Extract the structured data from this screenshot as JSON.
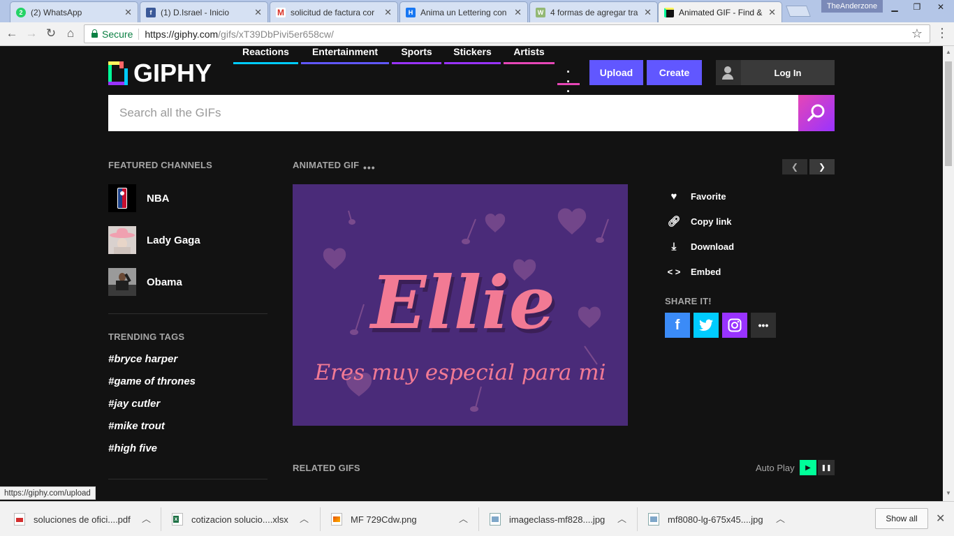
{
  "browser": {
    "tabs": [
      {
        "title": "(2) WhatsApp",
        "icon": "whatsapp-icon",
        "color": "#25d366",
        "glyph": "2"
      },
      {
        "title": "(1) D.Israel - Inicio",
        "icon": "facebook-icon",
        "color": "#3b5998",
        "glyph": "f"
      },
      {
        "title": "solicitud de factura cor",
        "icon": "gmail-icon",
        "color": "#ffffff",
        "glyph": "M"
      },
      {
        "title": "Anima un Lettering con",
        "icon": "hootsuite-icon",
        "color": "#1877f2",
        "glyph": "H"
      },
      {
        "title": "4 formas de agregar tra",
        "icon": "wikihow-icon",
        "color": "#93b874",
        "glyph": "W"
      },
      {
        "title": "Animated GIF - Find &",
        "icon": "giphy-icon",
        "color": "#121212",
        "glyph": ""
      }
    ],
    "profile_name": "TheAnderzone",
    "address": {
      "secure_label": "Secure",
      "url_host": "https://giphy.com",
      "url_path": "/gifs/xT39DbPivi5er658cw/"
    }
  },
  "header": {
    "logo_text": "GIPHY",
    "nav": [
      {
        "label": "Reactions",
        "color": "#00ccff"
      },
      {
        "label": "Entertainment",
        "color": "#6157ff"
      },
      {
        "label": "Sports",
        "color": "#9933ff"
      },
      {
        "label": "Stickers",
        "color": "#9933ff"
      },
      {
        "label": "Artists",
        "color": "#e646b6"
      }
    ],
    "upload_label": "Upload",
    "create_label": "Create",
    "login_label": "Log In"
  },
  "search": {
    "placeholder": "Search all the GIFs"
  },
  "sidebar": {
    "featured_title": "FEATURED CHANNELS",
    "channels": [
      {
        "name": "NBA",
        "icon": "nba-logo"
      },
      {
        "name": "Lady Gaga",
        "icon": "lady-gaga-avatar"
      },
      {
        "name": "Obama",
        "icon": "obama-avatar"
      }
    ],
    "trending_title": "TRENDING TAGS",
    "tags": [
      "#bryce harper",
      "#game of thrones",
      "#jay cutler",
      "#mike trout",
      "#high five"
    ]
  },
  "main": {
    "gif_title": "ANIMATED GIF",
    "gif_text_main": "Ellie",
    "gif_text_sub": "Eres muy especial para mi",
    "actions": [
      {
        "label": "Favorite",
        "icon": "heart-icon"
      },
      {
        "label": "Copy link",
        "icon": "link-icon"
      },
      {
        "label": "Download",
        "icon": "download-icon"
      },
      {
        "label": "Embed",
        "icon": "embed-icon"
      }
    ],
    "share_title": "SHARE IT!",
    "share": [
      {
        "name": "facebook",
        "color": "#3b8bf7"
      },
      {
        "name": "twitter",
        "color": "#00ccff"
      },
      {
        "name": "instagram",
        "color": "#9933ff"
      },
      {
        "name": "more",
        "color": "#2f2f2f"
      }
    ],
    "related_title": "RELATED GIFS",
    "autoplay_label": "Auto Play"
  },
  "status_url": "https://giphy.com/upload",
  "downloads": {
    "items": [
      {
        "name": "soluciones de ofici....pdf",
        "icon": "pdf-file-icon"
      },
      {
        "name": "cotizacion solucio....xlsx",
        "icon": "excel-file-icon"
      },
      {
        "name": "MF 729Cdw.png",
        "icon": "image-file-icon"
      },
      {
        "name": "imageclass-mf828....jpg",
        "icon": "image-file-icon"
      },
      {
        "name": "mf8080-lg-675x45....jpg",
        "icon": "image-file-icon"
      }
    ],
    "show_all_label": "Show all"
  }
}
